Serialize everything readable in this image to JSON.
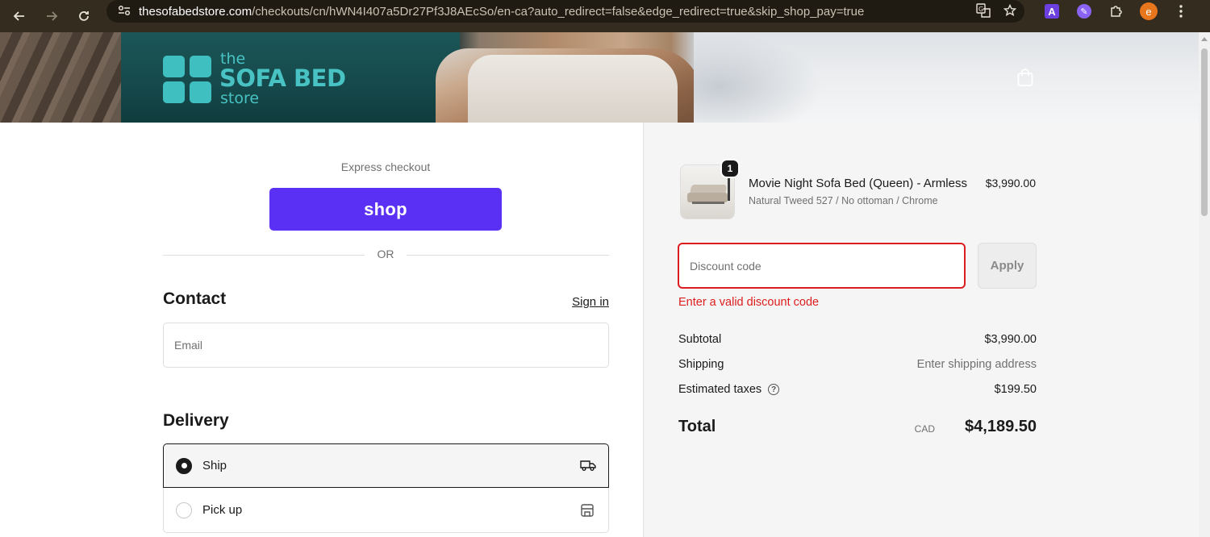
{
  "browser": {
    "url_host": "thesofabedstore.com",
    "url_path": "/checkouts/cn/hWN4I407a5Dr27Pf3J8AEcSo/en-ca?auto_redirect=false&edge_redirect=true&skip_shop_pay=true",
    "profile_initial": "e",
    "ext_a_label": "A",
    "icons": [
      "back-icon",
      "forward-icon",
      "reload-icon",
      "site-info-icon",
      "translate-icon",
      "star-icon",
      "extension-a-icon",
      "extension-purple-icon",
      "puzzle-icon",
      "avatar",
      "menu-dots-icon"
    ]
  },
  "header": {
    "logo_the": "the",
    "logo_main": "SOFA BED",
    "logo_store": "store",
    "cart_icon": "shopping-bag-icon",
    "logo_color": "#48c2c2"
  },
  "express": {
    "label": "Express checkout",
    "shop_button": "shop",
    "shop_color": "#5a31f4",
    "or_text": "OR"
  },
  "contact": {
    "title": "Contact",
    "sign_in": "Sign in",
    "email_placeholder": "Email"
  },
  "delivery": {
    "title": "Delivery",
    "options": [
      {
        "label": "Ship",
        "selected": true,
        "icon": "truck-icon"
      },
      {
        "label": "Pick up",
        "selected": false,
        "icon": "store-icon"
      }
    ]
  },
  "order": {
    "item": {
      "quantity": "1",
      "title": "Movie Night Sofa Bed (Queen) - Armless",
      "variant": "Natural Tweed 527 / No ottoman / Chrome",
      "price": "$3,990.00"
    },
    "discount": {
      "placeholder": "Discount code",
      "apply_label": "Apply",
      "error": "Enter a valid discount code",
      "error_color": "#dd1d1d"
    },
    "summary": {
      "subtotal_label": "Subtotal",
      "subtotal_value": "$3,990.00",
      "shipping_label": "Shipping",
      "shipping_value": "Enter shipping address",
      "taxes_label": "Estimated taxes",
      "taxes_value": "$199.50",
      "total_label": "Total",
      "currency": "CAD",
      "total_value": "$4,189.50"
    }
  }
}
